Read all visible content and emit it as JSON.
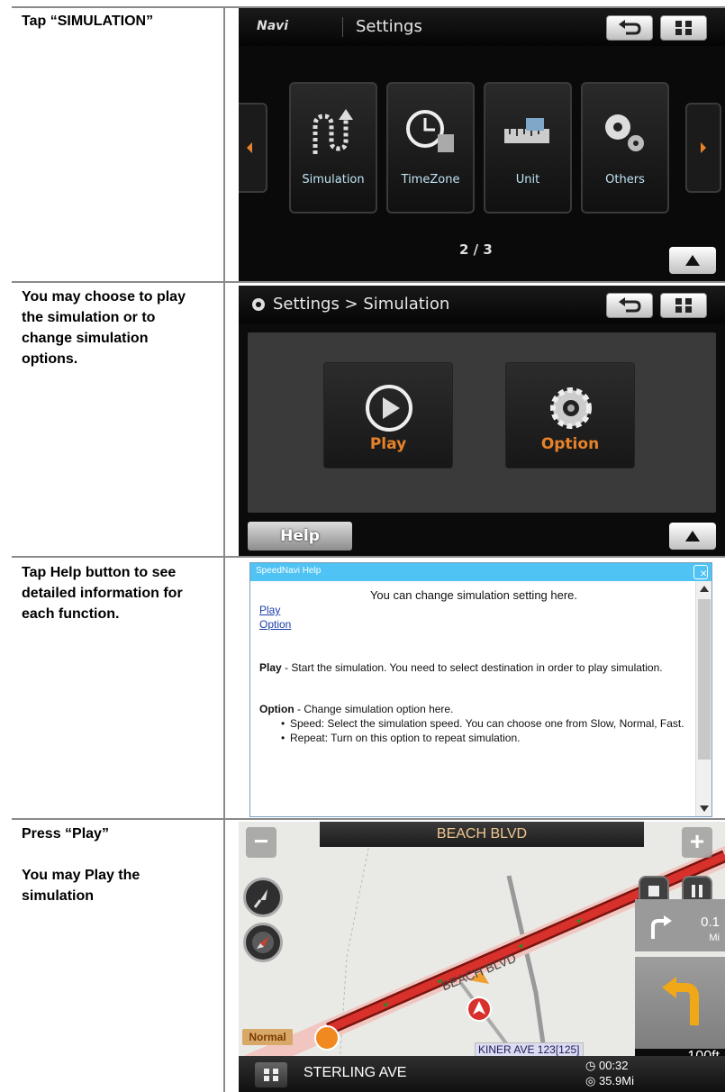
{
  "rows": [
    {
      "instruction": "Tap “SIMULATION”"
    },
    {
      "instruction": "You may choose to play\nthe simulation or to\nchange simulation\noptions."
    },
    {
      "instruction": "Tap Help button to see\ndetailed information for\neach function."
    },
    {
      "instruction": "Press “Play”\n\nYou may Play the\nsimulation"
    }
  ],
  "screen1": {
    "brand": "Navi",
    "title": "Settings",
    "tiles": [
      "Simulation",
      "TimeZone",
      "Unit",
      "Others"
    ],
    "pager": "2 / 3"
  },
  "screen2": {
    "breadcrumb": "Settings > Simulation",
    "play_label": "Play",
    "option_label": "Option",
    "help_label": "Help"
  },
  "screen3": {
    "window_title": "SpeedNavi Help",
    "intro": "You can change simulation setting here.",
    "link_play": "Play",
    "link_option": "Option",
    "play_head": "Play",
    "play_text": " - Start the simulation. You need to select destination in order to play simulation.",
    "option_head": "Option",
    "option_text": " - Change simulation option here.",
    "bullets": [
      "Speed: Select the simulation speed. You can choose one from Slow, Normal, Fast.",
      "Repeat: Turn on this option to repeat simulation."
    ]
  },
  "screen4": {
    "current_street": "BEACH BLVD",
    "road_label": "BEACH BLVD",
    "mode_label": "Normal",
    "next_dist_value": "0.1",
    "next_dist_unit": "Mi",
    "turn_dist": "100ft",
    "cross_label": "KINER AVE 123[125]",
    "bottom_street": "STERLING AVE",
    "time": "00:32",
    "distance": "35.9Mi"
  },
  "colors": {
    "help_bar": "#4fc3f3",
    "route": "#d0302a",
    "accent_orange": "#e8822a"
  }
}
